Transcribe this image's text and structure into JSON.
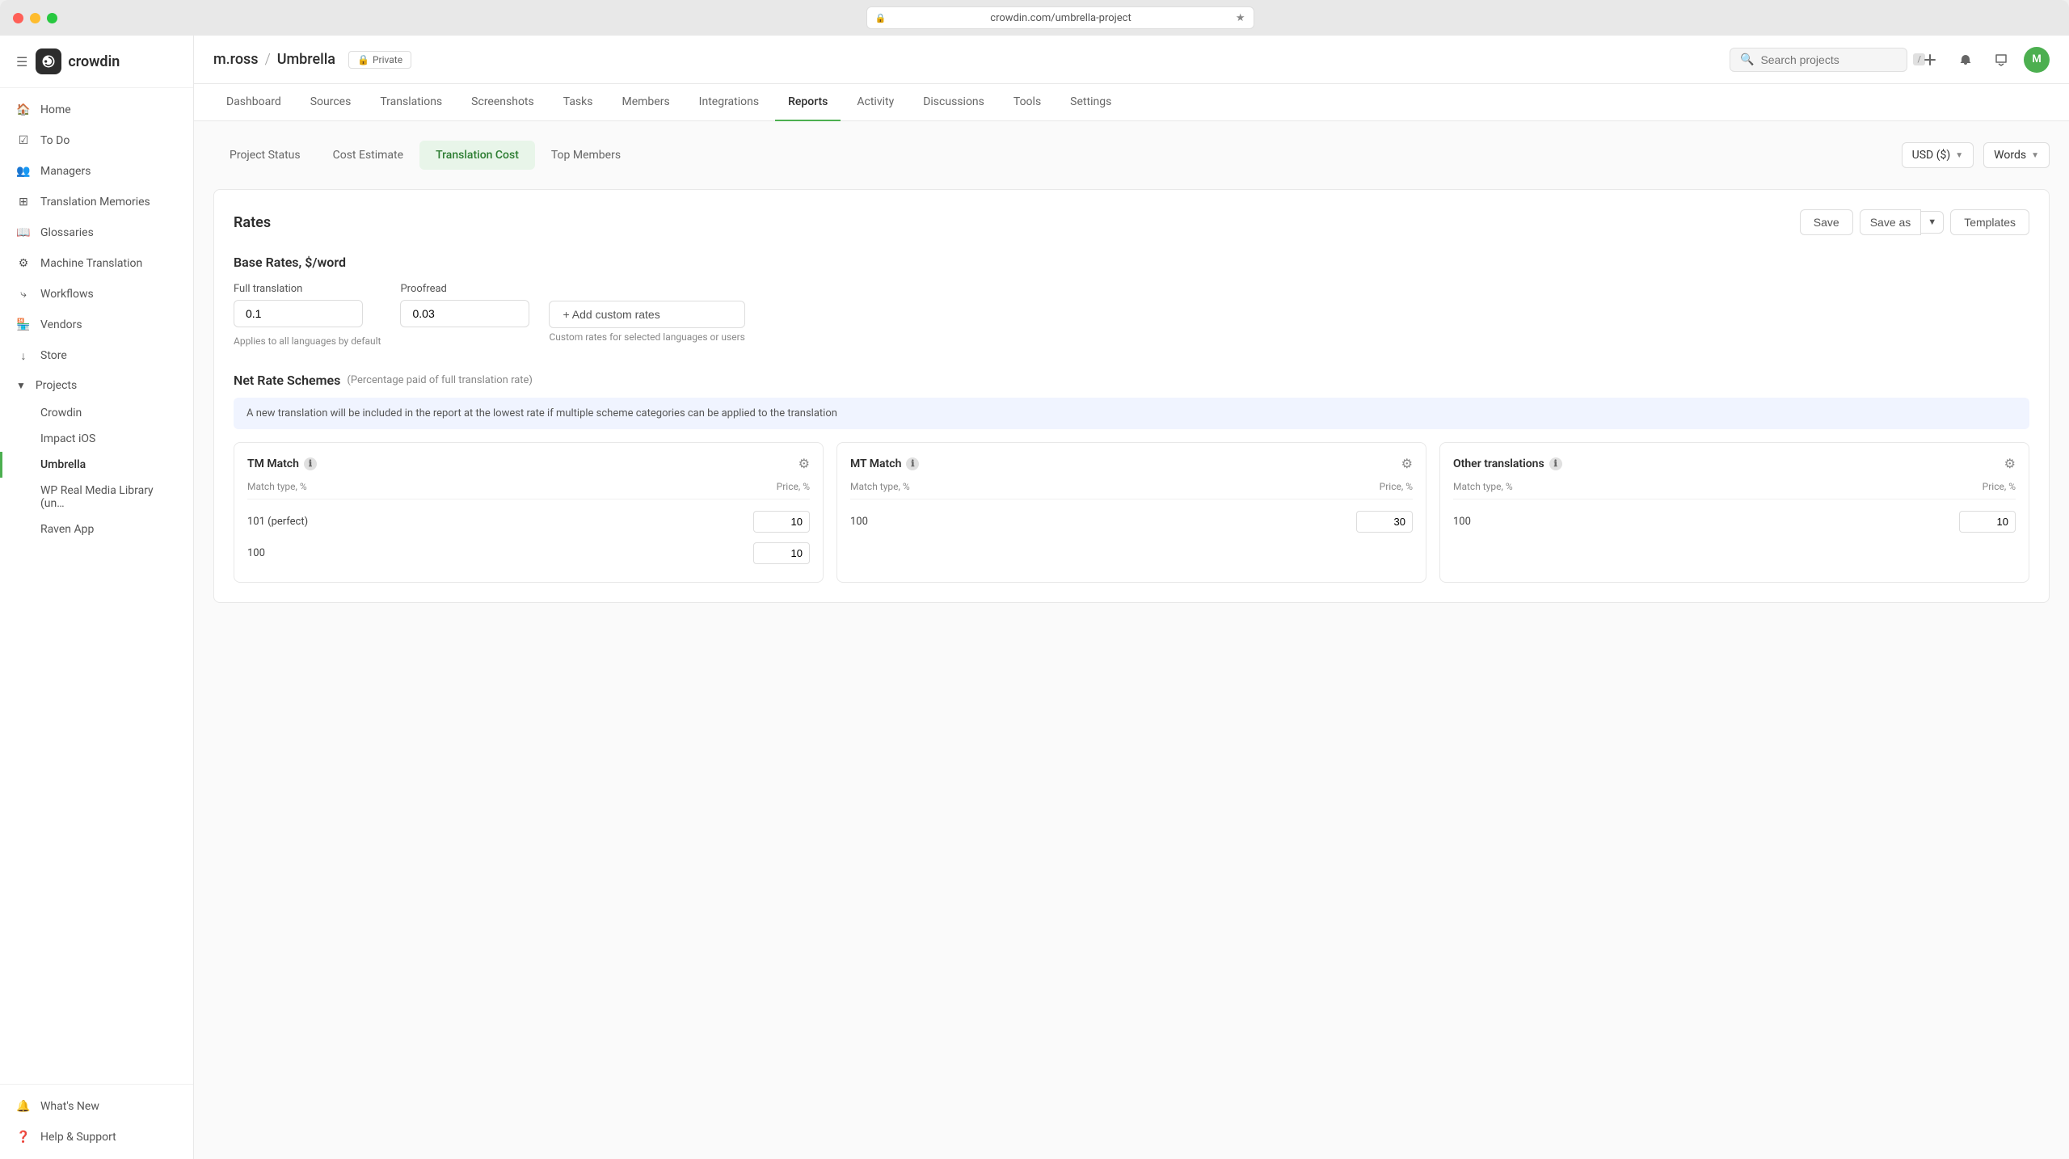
{
  "window": {
    "address": "crowdin.com/umbrella-project",
    "favicon": "🔒"
  },
  "sidebar": {
    "brand": "crowdin",
    "nav_items": [
      {
        "id": "home",
        "label": "Home",
        "icon": "home"
      },
      {
        "id": "todo",
        "label": "To Do",
        "icon": "todo"
      },
      {
        "id": "managers",
        "label": "Managers",
        "icon": "managers"
      },
      {
        "id": "translation-memories",
        "label": "Translation Memories",
        "icon": "tm"
      },
      {
        "id": "glossaries",
        "label": "Glossaries",
        "icon": "glossaries"
      },
      {
        "id": "machine-translation",
        "label": "Machine Translation",
        "icon": "mt"
      },
      {
        "id": "workflows",
        "label": "Workflows",
        "icon": "workflows"
      },
      {
        "id": "vendors",
        "label": "Vendors",
        "icon": "vendors"
      },
      {
        "id": "store",
        "label": "Store",
        "icon": "store"
      }
    ],
    "projects_label": "Projects",
    "projects": [
      {
        "id": "crowdin",
        "label": "Crowdin",
        "active": false
      },
      {
        "id": "impact-ios",
        "label": "Impact iOS",
        "active": false
      },
      {
        "id": "umbrella",
        "label": "Umbrella",
        "active": true
      },
      {
        "id": "wp-real-media",
        "label": "WP Real Media Library (un…",
        "active": false
      },
      {
        "id": "raven-app",
        "label": "Raven App",
        "active": false
      }
    ],
    "bottom_items": [
      {
        "id": "whats-new",
        "label": "What's New",
        "icon": "whats-new"
      },
      {
        "id": "help-support",
        "label": "Help & Support",
        "icon": "help"
      }
    ]
  },
  "topbar": {
    "breadcrumb_owner": "m.ross",
    "breadcrumb_sep": "/",
    "breadcrumb_project": "Umbrella",
    "private_label": "Private",
    "search_placeholder": "Search projects",
    "slash_hint": "/"
  },
  "nav_tabs": [
    {
      "id": "dashboard",
      "label": "Dashboard",
      "active": false
    },
    {
      "id": "sources",
      "label": "Sources",
      "active": false
    },
    {
      "id": "translations",
      "label": "Translations",
      "active": false
    },
    {
      "id": "screenshots",
      "label": "Screenshots",
      "active": false
    },
    {
      "id": "tasks",
      "label": "Tasks",
      "active": false
    },
    {
      "id": "members",
      "label": "Members",
      "active": false
    },
    {
      "id": "integrations",
      "label": "Integrations",
      "active": false
    },
    {
      "id": "reports",
      "label": "Reports",
      "active": true
    },
    {
      "id": "activity",
      "label": "Activity",
      "active": false
    },
    {
      "id": "discussions",
      "label": "Discussions",
      "active": false
    },
    {
      "id": "tools",
      "label": "Tools",
      "active": false
    },
    {
      "id": "settings",
      "label": "Settings",
      "active": false
    }
  ],
  "sub_tabs": [
    {
      "id": "project-status",
      "label": "Project Status",
      "active": false
    },
    {
      "id": "cost-estimate",
      "label": "Cost Estimate",
      "active": false
    },
    {
      "id": "translation-cost",
      "label": "Translation Cost",
      "active": true
    },
    {
      "id": "top-members",
      "label": "Top Members",
      "active": false
    }
  ],
  "filters": {
    "currency": "USD ($)",
    "unit": "Words"
  },
  "rates_card": {
    "title": "Rates",
    "save_label": "Save",
    "save_as_label": "Save as",
    "templates_label": "Templates",
    "base_rates_title": "Base Rates, $/word",
    "full_translation_label": "Full translation",
    "full_translation_value": "0.1",
    "proofread_label": "Proofread",
    "proofread_value": "0.03",
    "applies_note": "Applies to all languages by default",
    "add_custom_label": "+ Add custom rates",
    "custom_note": "Custom rates for selected languages or users",
    "net_rate_title": "Net Rate Schemes",
    "net_rate_subtitle": "(Percentage paid of full translation rate)",
    "info_banner": "A new translation will be included in the report at the lowest rate if multiple scheme categories can be applied to the translation",
    "schemes": [
      {
        "id": "tm-match",
        "title": "TM Match",
        "col_match": "Match type, %",
        "col_price": "Price, %",
        "rows": [
          {
            "label": "101 (perfect)",
            "value": "10"
          },
          {
            "label": "100",
            "value": "10"
          }
        ]
      },
      {
        "id": "mt-match",
        "title": "MT Match",
        "col_match": "Match type, %",
        "col_price": "Price, %",
        "rows": [
          {
            "label": "100",
            "value": "30"
          }
        ]
      },
      {
        "id": "other-translations",
        "title": "Other translations",
        "col_match": "Match type, %",
        "col_price": "Price, %",
        "rows": [
          {
            "label": "100",
            "value": "10"
          }
        ]
      }
    ]
  }
}
